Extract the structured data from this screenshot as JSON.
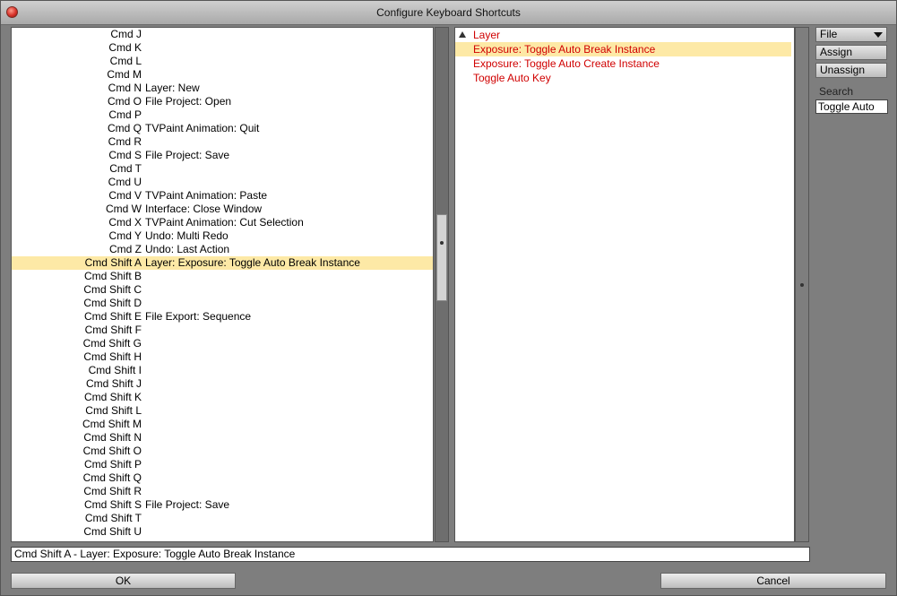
{
  "window": {
    "title": "Configure Keyboard Shortcuts"
  },
  "shortcuts": [
    {
      "key": "Cmd J",
      "action": ""
    },
    {
      "key": "Cmd K",
      "action": ""
    },
    {
      "key": "Cmd L",
      "action": ""
    },
    {
      "key": "Cmd M",
      "action": ""
    },
    {
      "key": "Cmd N",
      "action": "Layer: New"
    },
    {
      "key": "Cmd O",
      "action": "File Project: Open"
    },
    {
      "key": "Cmd P",
      "action": ""
    },
    {
      "key": "Cmd Q",
      "action": "TVPaint Animation: Quit"
    },
    {
      "key": "Cmd R",
      "action": ""
    },
    {
      "key": "Cmd S",
      "action": "File Project: Save"
    },
    {
      "key": "Cmd T",
      "action": ""
    },
    {
      "key": "Cmd U",
      "action": ""
    },
    {
      "key": "Cmd V",
      "action": "TVPaint Animation: Paste"
    },
    {
      "key": "Cmd W",
      "action": "Interface: Close Window"
    },
    {
      "key": "Cmd X",
      "action": "TVPaint Animation: Cut Selection"
    },
    {
      "key": "Cmd Y",
      "action": "Undo: Multi Redo"
    },
    {
      "key": "Cmd Z",
      "action": "Undo: Last Action"
    },
    {
      "key": "Cmd Shift A",
      "action": "Layer: Exposure: Toggle Auto Break Instance",
      "selected": true
    },
    {
      "key": "Cmd Shift B",
      "action": ""
    },
    {
      "key": "Cmd Shift C",
      "action": ""
    },
    {
      "key": "Cmd Shift D",
      "action": ""
    },
    {
      "key": "Cmd Shift E",
      "action": "File Export: Sequence"
    },
    {
      "key": "Cmd Shift F",
      "action": ""
    },
    {
      "key": "Cmd Shift G",
      "action": ""
    },
    {
      "key": "Cmd Shift H",
      "action": ""
    },
    {
      "key": "Cmd Shift I",
      "action": ""
    },
    {
      "key": "Cmd Shift J",
      "action": ""
    },
    {
      "key": "Cmd Shift K",
      "action": ""
    },
    {
      "key": "Cmd Shift L",
      "action": ""
    },
    {
      "key": "Cmd Shift M",
      "action": ""
    },
    {
      "key": "Cmd Shift N",
      "action": ""
    },
    {
      "key": "Cmd Shift O",
      "action": ""
    },
    {
      "key": "Cmd Shift P",
      "action": ""
    },
    {
      "key": "Cmd Shift Q",
      "action": ""
    },
    {
      "key": "Cmd Shift R",
      "action": ""
    },
    {
      "key": "Cmd Shift S",
      "action": "File Project: Save"
    },
    {
      "key": "Cmd Shift T",
      "action": ""
    },
    {
      "key": "Cmd Shift U",
      "action": ""
    }
  ],
  "actions_tree": {
    "category": "Layer",
    "items": [
      {
        "label": "Exposure: Toggle Auto Break Instance",
        "selected": true
      },
      {
        "label": "Exposure: Toggle Auto Create Instance",
        "selected": false
      },
      {
        "label": "Toggle Auto Key",
        "selected": false
      }
    ]
  },
  "side_panel": {
    "file_dropdown": "File",
    "assign_label": "Assign",
    "unassign_label": "Unassign",
    "search_label": "Search",
    "search_value": "Toggle Auto"
  },
  "status_text": "Cmd Shift A - Layer: Exposure: Toggle Auto Break Instance",
  "buttons": {
    "ok": "OK",
    "cancel": "Cancel"
  },
  "colors": {
    "selection": "#fde9a6",
    "action_text": "#d00000",
    "window_bg": "#7e7e7e"
  }
}
